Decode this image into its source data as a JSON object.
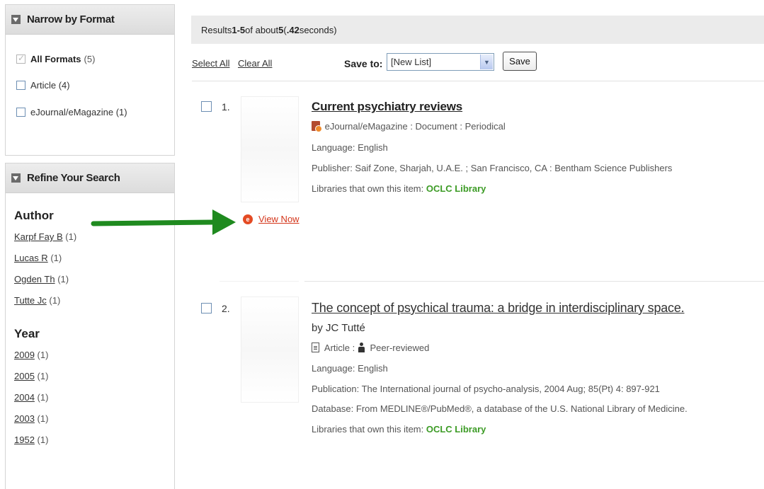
{
  "sidebar": {
    "format_panel": {
      "title": "Narrow by Format",
      "items": [
        {
          "label": "All Formats",
          "count": "(5)",
          "checked": true
        },
        {
          "label": "Article (4)",
          "checked": false
        },
        {
          "label": "eJournal/eMagazine (1)",
          "checked": false
        }
      ]
    },
    "refine_panel": {
      "title": "Refine Your Search",
      "author": {
        "title": "Author",
        "items": [
          {
            "label": "Karpf Fay B",
            "count": "(1)"
          },
          {
            "label": "Lucas R",
            "count": "(1)"
          },
          {
            "label": "Ogden Th",
            "count": "(1)"
          },
          {
            "label": "Tutte Jc",
            "count": "(1)"
          }
        ]
      },
      "year": {
        "title": "Year",
        "items": [
          {
            "label": "2009",
            "count": "(1)"
          },
          {
            "label": "2005",
            "count": "(1)"
          },
          {
            "label": "2004",
            "count": "(1)"
          },
          {
            "label": "2003",
            "count": "(1)"
          },
          {
            "label": "1952",
            "count": "(1)"
          }
        ]
      }
    }
  },
  "results_bar": {
    "prefix": "Results ",
    "range": "1-5",
    "mid": " of about ",
    "total": "5",
    "time_open": " (",
    "time": ".42",
    "time_close": " seconds)"
  },
  "toolbar": {
    "select_all": "Select All",
    "clear_all": "Clear All",
    "save_to_label": "Save to:",
    "save_to_value": "[New List]",
    "save_button": "Save"
  },
  "records": [
    {
      "number": "1.",
      "title": "Current psychiatry reviews",
      "format": "eJournal/eMagazine : Document : Periodical",
      "language": "Language: English",
      "publisher": "Publisher: Saif Zone, Sharjah, U.A.E. ; San Francisco, CA : Bentham Science Publishers",
      "libraries_label": "Libraries that own this item: ",
      "libraries_value": "OCLC Library",
      "view_now": "View Now"
    },
    {
      "number": "2.",
      "title": "The concept of psychical trauma: a bridge in interdisciplinary space.",
      "author": "by JC Tutté",
      "format_article": "Article",
      "format_sep": " : ",
      "format_peer": "Peer-reviewed",
      "language": "Language: English",
      "publication": "Publication: The International journal of psycho-analysis, 2004 Aug; 85(Pt) 4: 897-921",
      "database": "Database: From MEDLINE®/PubMed®, a database of the U.S. National Library of Medicine.",
      "libraries_label": "Libraries that own this item: ",
      "libraries_value": "OCLC Library"
    }
  ],
  "colors": {
    "annotation_arrow": "#1f8a1f",
    "owned_library": "#3c9b25",
    "view_now": "#d4361b"
  },
  "icons": {
    "panel_toggle": "collapse-triangle-icon",
    "ejournal": "ejournal-icon",
    "article": "document-icon",
    "peer_reviewed": "peer-reviewed-icon",
    "view_now": "view-now-icon",
    "select_arrow": "chevron-down-icon"
  }
}
